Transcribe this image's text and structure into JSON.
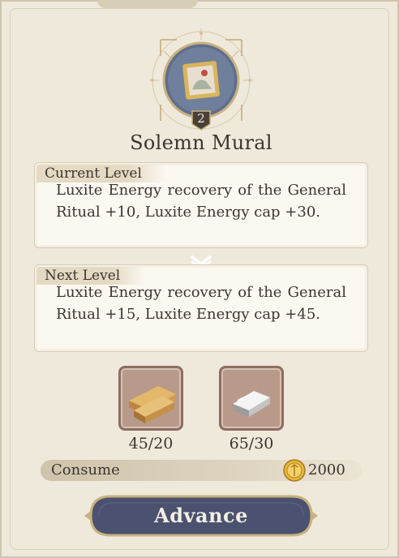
{
  "item": {
    "name": "Solemn Mural",
    "level_badge": "2"
  },
  "current": {
    "label": "Current Level",
    "text": "Luxite Energy recovery of the General Ritual +10, Luxite Energy cap +30."
  },
  "next": {
    "label": "Next Level",
    "text": "Luxite Energy recovery of the General Ritual +15, Luxite Energy cap +45."
  },
  "materials": [
    {
      "icon": "wood-planks-icon",
      "count": "45/20"
    },
    {
      "icon": "silver-ingot-icon",
      "count": "65/30"
    }
  ],
  "consume": {
    "label": "Consume",
    "icon": "gold-coin-icon",
    "amount": "2000"
  },
  "actions": {
    "advance_label": "Advance"
  },
  "colors": {
    "panel_bg": "#efe9dc",
    "button_bg": "#4a5270",
    "text": "#3c352f",
    "material_bg": "#b89a8b"
  }
}
